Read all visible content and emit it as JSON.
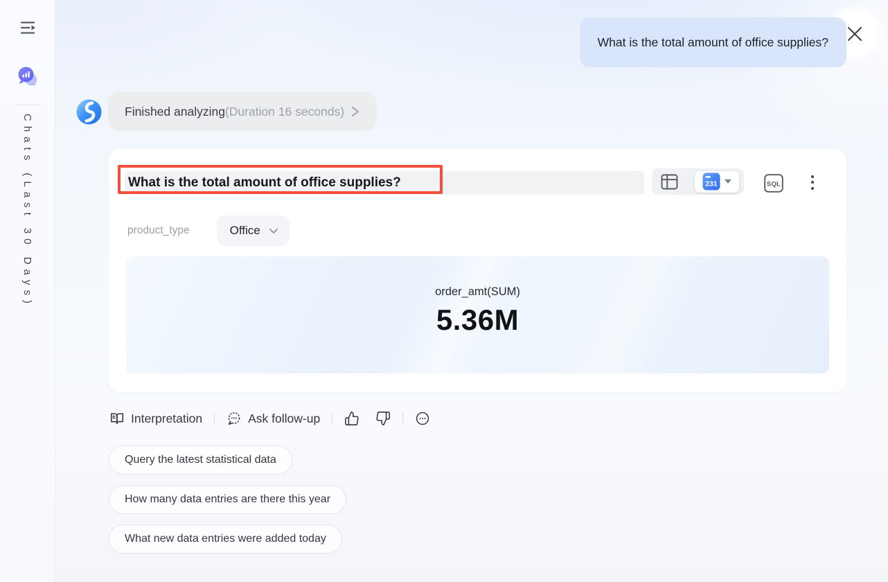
{
  "sidebar": {
    "label": "Chats (Last 30 Days)"
  },
  "chat": {
    "user_message": "What is the total amount of office supplies?",
    "status": {
      "title": "Finished analyzing",
      "duration": "(Duration 16 seconds)"
    }
  },
  "card": {
    "title": "What is the total amount of office supplies?",
    "toolbar": {
      "chart_badge": "231",
      "sql_label": "SQL"
    },
    "filter": {
      "field": "product_type",
      "value": "Office"
    },
    "kpi": {
      "metric": "order_amt(SUM)",
      "value": "5.36M"
    }
  },
  "actions": {
    "interpretation": "Interpretation",
    "ask_follow_up": "Ask follow-up"
  },
  "suggestions": [
    "Query the latest statistical data",
    "How many data entries are there this year",
    "What new data entries were added today"
  ],
  "icons": {
    "sidebar_toggle": "three-lines-with-right-arrow",
    "chat": "chat-bubble-with-bars",
    "close": "x",
    "status_chevron": "chevron-right",
    "table_view": "table-grid",
    "chart_type": "blue-kpi-card",
    "caret": "caret-down",
    "more": "vertical-ellipsis",
    "filter_chevron": "chevron-down",
    "interpretation": "open-book",
    "ask_follow_up": "speech-bubble-ellipsis",
    "like": "thumbs-up",
    "dislike": "thumbs-down",
    "overflow": "circled-ellipsis"
  },
  "colors": {
    "accent_blue": "#2f6ef2",
    "annotation_red": "#f2503d",
    "user_bubble": "#d8e5fb",
    "panel_blue": "#e9f1fc"
  }
}
